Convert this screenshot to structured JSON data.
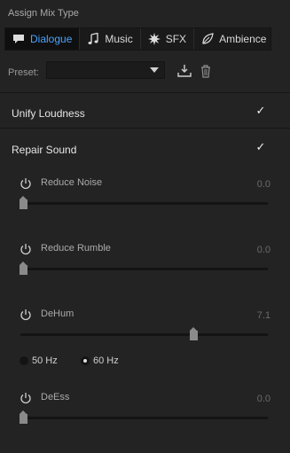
{
  "header": {
    "title": "Assign Mix Type"
  },
  "tabs": [
    {
      "label": "Dialogue",
      "icon": "speech-bubble-icon",
      "active": true
    },
    {
      "label": "Music",
      "icon": "music-note-icon",
      "active": false
    },
    {
      "label": "SFX",
      "icon": "burst-icon",
      "active": false
    },
    {
      "label": "Ambience",
      "icon": "leaf-icon",
      "active": false
    }
  ],
  "preset": {
    "label": "Preset:",
    "value": ""
  },
  "unify_loudness": {
    "label": "Unify Loudness",
    "checked": true
  },
  "repair_sound": {
    "label": "Repair Sound",
    "checked": true
  },
  "params": {
    "reduce_noise": {
      "label": "Reduce Noise",
      "value": "0.0",
      "fraction": 0.0
    },
    "reduce_rumble": {
      "label": "Reduce Rumble",
      "value": "0.0",
      "fraction": 0.0
    },
    "dehum": {
      "label": "DeHum",
      "value": "7.1",
      "fraction": 0.71
    },
    "deess": {
      "label": "DeEss",
      "value": "0.0",
      "fraction": 0.0
    }
  },
  "dehum_freq": {
    "options": [
      {
        "label": "50 Hz",
        "selected": false
      },
      {
        "label": "60 Hz",
        "selected": true
      }
    ]
  },
  "colors": {
    "accent": "#4aa3ff",
    "background": "#232323"
  }
}
